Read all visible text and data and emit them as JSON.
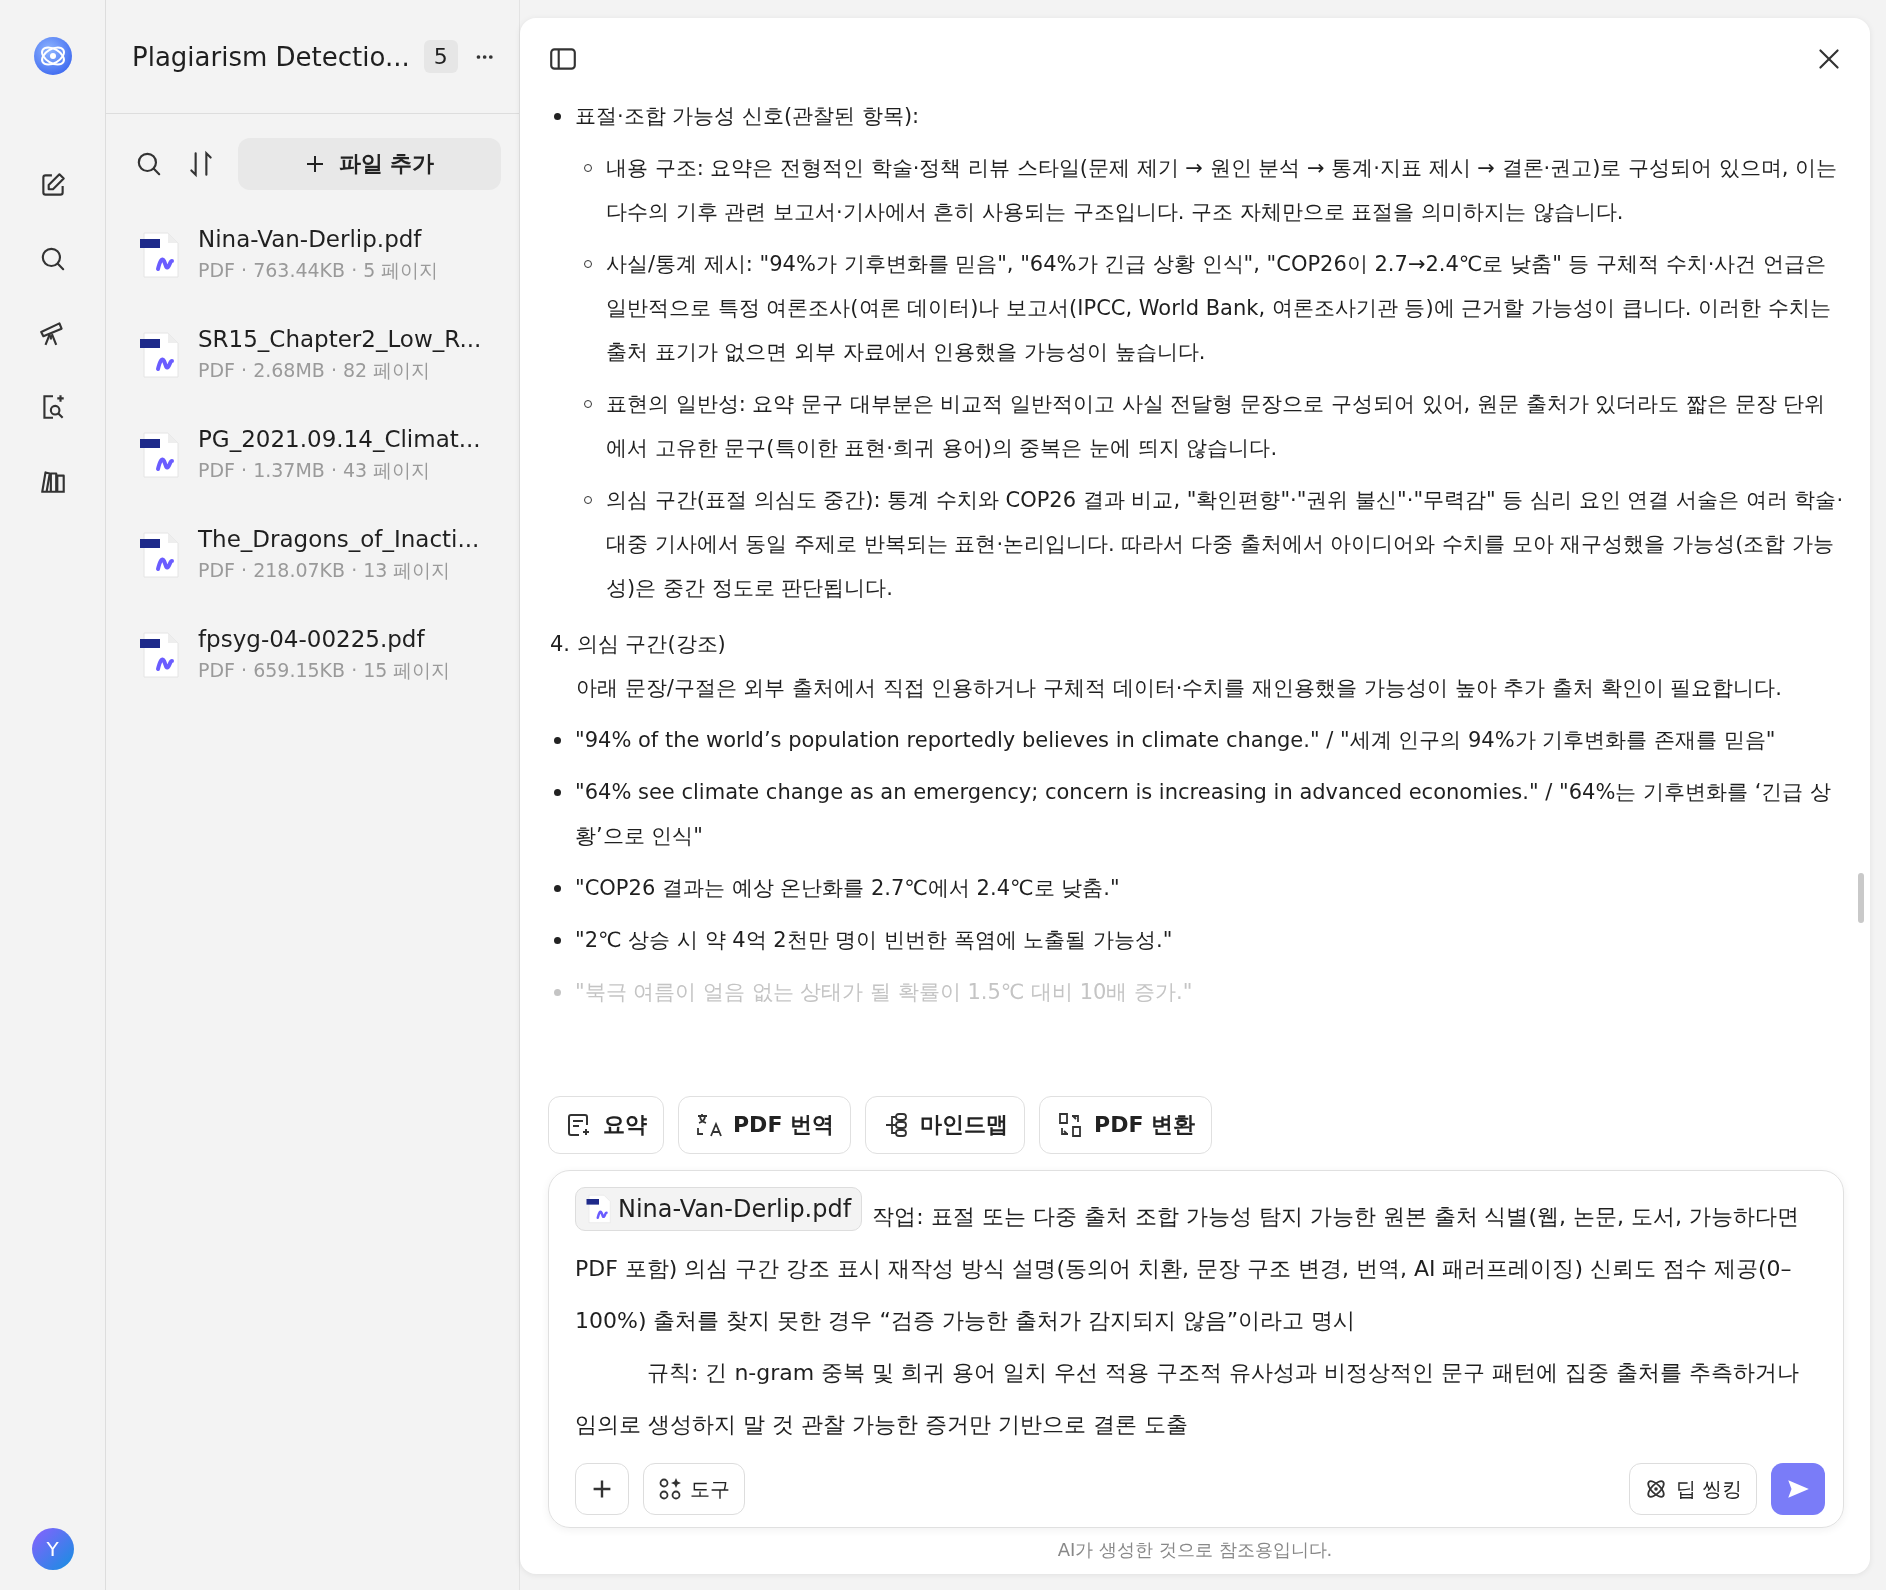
{
  "rail": {
    "avatar_letter": "Y"
  },
  "files_panel": {
    "title": "Plagiarism Detectio...",
    "count": "5",
    "add_button": "파일 추가",
    "files": [
      {
        "name": "Nina-Van-Derlip.pdf",
        "meta": "PDF · 763.44KB · 5 페이지"
      },
      {
        "name": "SR15_Chapter2_Low_R...",
        "meta": "PDF · 2.68MB · 82 페이지"
      },
      {
        "name": "PG_2021.09.14_Climat...",
        "meta": "PDF · 1.37MB · 43 페이지"
      },
      {
        "name": "The_Dragons_of_Inacti...",
        "meta": "PDF · 218.07KB · 13 페이지"
      },
      {
        "name": "fpsyg-04-00225.pdf",
        "meta": "PDF · 659.15KB · 15 페이지"
      }
    ]
  },
  "content": {
    "section_bullet": "표절·조합 가능성 신호(관찰된 항목):",
    "sub_bullets": [
      "내용 구조: 요약은 전형적인 학술·정책 리뷰 스타일(문제 제기 → 원인 분석 → 통계·지표 제시 → 결론·권고)로 구성되어 있으며, 이는 다수의 기후 관련 보고서·기사에서 흔히 사용되는 구조입니다. 구조 자체만으로 표절을 의미하지는 않습니다.",
      "사실/통계 제시: \"94%가 기후변화를 믿음\", \"64%가 긴급 상황 인식\", \"COP26이 2.7→2.4℃로 낮춤\" 등 구체적 수치·사건 언급은 일반적으로 특정 여론조사(여론 데이터)나 보고서(IPCC, World Bank, 여론조사기관 등)에 근거할 가능성이 큽니다. 이러한 수치는 출처 표기가 없으면 외부 자료에서 인용했을 가능성이 높습니다.",
      "표현의 일반성: 요약 문구 대부분은 비교적 일반적이고 사실 전달형 문장으로 구성되어 있어, 원문 출처가 있더라도 짧은 문장 단위에서 고유한 문구(특이한 표현·희귀 용어)의 중복은 눈에 띄지 않습니다.",
      "의심 구간(표절 의심도 중간): 통계 수치와 COP26 결과 비교, \"확인편향\"·\"권위 불신\"·\"무력감\" 등 심리 요인 연결 서술은 여러 학술·대중 기사에서 동일 주제로 반복되는 표현·논리입니다. 따라서 다중 출처에서 아이디어와 수치를 모아 재구성했을 가능성(조합 가능성)은 중간 정도로 판단됩니다."
    ],
    "heading": "4. 의심 구간(강조)",
    "intro": "아래 문장/구절은 외부 출처에서 직접 인용하거나 구체적 데이터·수치를 재인용했을 가능성이 높아 추가 출처 확인이 필요합니다.",
    "quotes": [
      {
        "text": "\"94% of the world’s population reportedly believes in climate change.\" / \"세계 인구의 94%가 기후변화를 존재를 믿음\"",
        "faded": false
      },
      {
        "text": "\"64% see climate change as an emergency; concern is increasing in advanced economies.\" / \"64%는 기후변화를 ‘긴급 상황’으로 인식\"",
        "faded": false
      },
      {
        "text": "\"COP26 결과는 예상 온난화를 2.7℃에서 2.4℃로 낮춤.\"",
        "faded": false
      },
      {
        "text": "\"2℃ 상승 시 약 4억 2천만 명이 빈번한 폭염에 노출될 가능성.\"",
        "faded": false
      },
      {
        "text": "\"북극 여름이 얼음 없는 상태가 될 확률이 1.5℃ 대비 10배 증가.\"",
        "faded": true
      }
    ]
  },
  "actions": [
    {
      "label": "요약",
      "kind": "summary"
    },
    {
      "label": "PDF 번역",
      "kind": "translate"
    },
    {
      "label": "마인드맵",
      "kind": "mindmap"
    },
    {
      "label": "PDF 변환",
      "kind": "convert"
    }
  ],
  "composer": {
    "attachment": "Nina-Van-Derlip.pdf",
    "paragraphs": [
      "작업: 표절 또는 다중 출처 조합 가능성 탐지 가능한 원본 출처 식별(웹, 논문, 도서, 가능하다면 PDF 포함) 의심 구간 강조 표시 재작성 방식 설명(동의어 치환, 문장 구조 변경, 번역, AI 패러프레이징) 신뢰도 점수 제공(0–100%) 출처를 찾지 못한 경우 “검증 가능한 출처가 감지되지 않음”이라고 명시",
      "규칙: 긴 n-gram 중복 및 희귀 용어 일치 우선 적용 구조적 유사성과 비정상적인 문구 패턴에 집중 출처를 추측하거나 임의로 생성하지 말 것 관찰 가능한 증거만 기반으로 결론 도출"
    ],
    "tools_button": "도구",
    "deep_thinking_button": "딥 씽킹"
  },
  "footer_note": "AI가 생성한 것으로 참조용입니다."
}
